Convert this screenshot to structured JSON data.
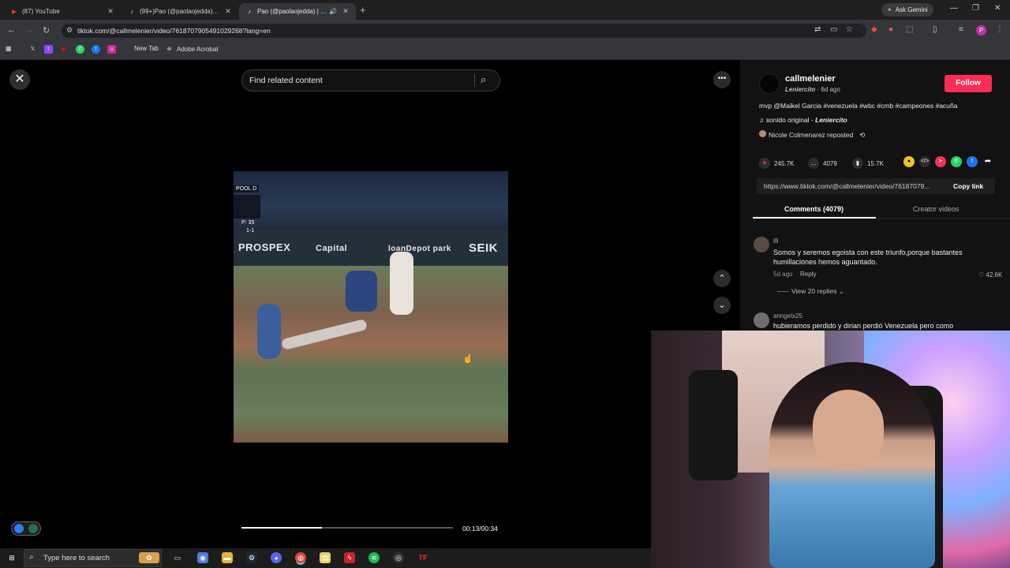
{
  "browser": {
    "tabs": [
      {
        "title": "(87) YouTube",
        "favicon": "youtube-icon",
        "color": "#ff0000"
      },
      {
        "title": "(99+)Pao (@paolaojedda) | TikT",
        "favicon": "tiktok-icon",
        "color": "#ffffff"
      },
      {
        "title": "Pao (@paolaojedda) | TikTo",
        "favicon": "tiktok-icon",
        "color": "#ffffff"
      }
    ],
    "ask_gemini": "Ask Gemini",
    "url": "tiktok.com/@callmelenier/video/7618707905491029268?lang=en",
    "bookmarks": [
      {
        "label": "New Tab"
      },
      {
        "label": "Adobe Acrobat"
      }
    ]
  },
  "player": {
    "search_placeholder": "Find related content",
    "overlay": {
      "pool": "POOL D",
      "pitch_count": "P: 35",
      "count": "1-1"
    },
    "ads": [
      "PROSPEX",
      "Capital",
      "loanDepot park",
      "SEIK"
    ],
    "time": "00:13/00:34",
    "progress": 0.38
  },
  "post": {
    "username": "callmelenier",
    "nickname": "Leniercito",
    "age": "6d ago",
    "follow_label": "Follow",
    "caption": "mvp @Maikel Garcia #venezuela #wbc #cmb #campeones #acuña",
    "sound_prefix": "sonido original - ",
    "sound_author": "Leniercito",
    "repost": "Nicole Colmenarez reposted",
    "likes": "245.7K",
    "comments": "4079",
    "saves": "15.7K",
    "link": "https://www.tiktok.com/@callmelenier/video/76187079...",
    "copy_link": "Copy link",
    "tab_comments": "Comments (4079)",
    "tab_creator": "Creator videos"
  },
  "comments": [
    {
      "text": "Somos y seremos egoista con este triunfo,porque bastantes humillaciones hemos aguantado.",
      "age": "5d ago",
      "reply": "Reply",
      "likes": "42.6K",
      "view_replies": "View 20 replies"
    },
    {
      "user": "anngelx25",
      "text": "hubieramos perdido y dirian perdió Venezuela pero como"
    }
  ],
  "taskbar": {
    "search_placeholder": "Type here to search"
  },
  "colors": {
    "accent": "#fe2c55",
    "panel": "#121212"
  }
}
